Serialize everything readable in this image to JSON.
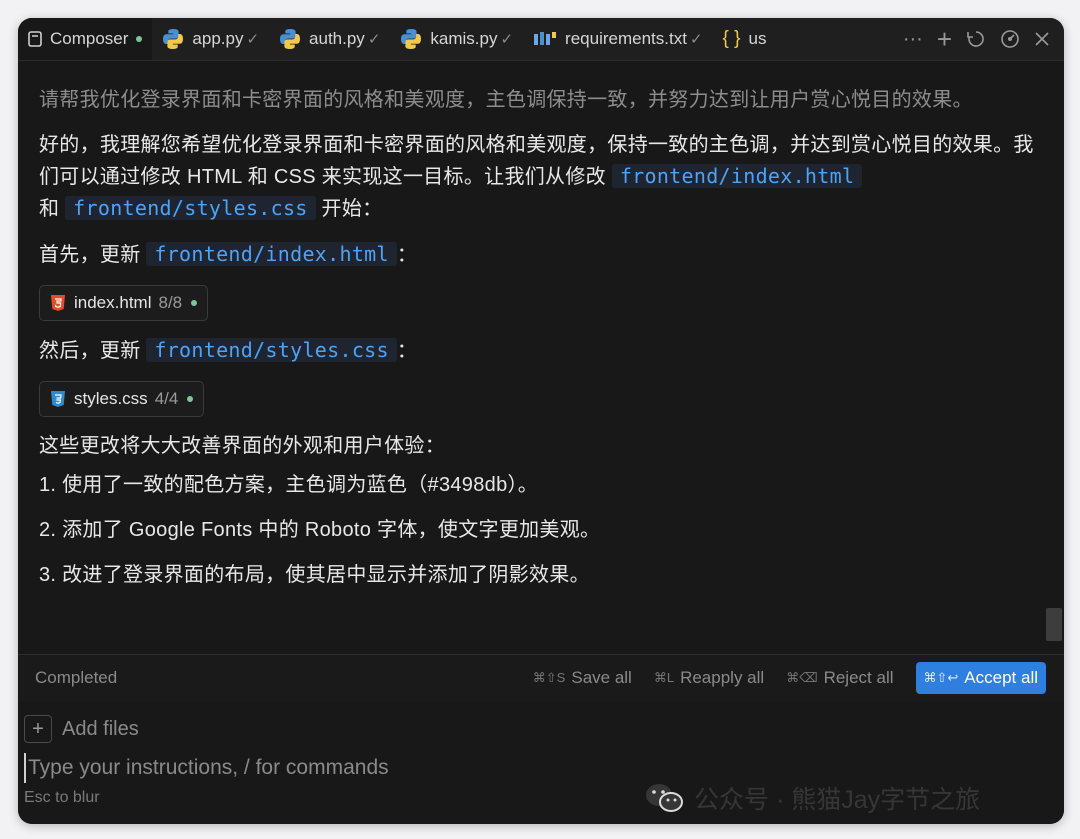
{
  "tabs": [
    {
      "label": "Composer",
      "icon": "document-icon",
      "status": "dot"
    },
    {
      "label": "app.py",
      "icon": "python-icon",
      "status": "check"
    },
    {
      "label": "auth.py",
      "icon": "python-icon",
      "status": "check"
    },
    {
      "label": "kamis.py",
      "icon": "python-icon",
      "status": "check"
    },
    {
      "label": "requirements.txt",
      "icon": "requirements-icon",
      "status": "check"
    },
    {
      "label": "us",
      "icon": "braces-icon",
      "status": ""
    }
  ],
  "tab_actions": {
    "more": "···",
    "add": "+"
  },
  "messages": {
    "user": "请帮我优化登录界面和卡密界面的风格和美观度，主色调保持一致，并努力达到让用户赏心悦目的效果。",
    "reply_p1_a": "好的，我理解您希望优化登录界面和卡密界面的风格和美观度，保持一致的主色调，并达到赏心悦目的效果。我们可以通过修改 HTML 和 CSS 来实现这一目标。让我们从修改",
    "reply_p1_code1": "frontend/index.html",
    "reply_p1_b": "和",
    "reply_p1_code2": "frontend/styles.css",
    "reply_p1_c": "开始：",
    "first_label": "首先，更新",
    "first_code": "frontend/index.html",
    "first_tail": "：",
    "chip1": {
      "name": "index.html",
      "count": "8/8"
    },
    "then_label": "然后，更新",
    "then_code": "frontend/styles.css",
    "then_tail": "：",
    "chip2": {
      "name": "styles.css",
      "count": "4/4"
    },
    "summary": "这些更改将大大改善界面的外观和用户体验：",
    "items": [
      "1. 使用了一致的配色方案，主色调为蓝色（#3498db）。",
      "2. 添加了 Google Fonts 中的 Roboto 字体，使文字更加美观。",
      "3. 改进了登录界面的布局，使其居中显示并添加了阴影效果。"
    ]
  },
  "statusbar": {
    "status": "Completed",
    "save": {
      "kbd": "⌘⇧S",
      "label": "Save all"
    },
    "reapply": {
      "kbd": "⌘L",
      "label": "Reapply all"
    },
    "reject": {
      "kbd": "⌘⌫",
      "label": "Reject all"
    },
    "accept": {
      "kbd": "⌘⇧↩",
      "label": "Accept all"
    }
  },
  "input": {
    "add_files": "Add files",
    "placeholder": "Type your instructions, / for commands",
    "hint": "Esc to blur"
  },
  "watermark": "公众号 · 熊猫Jay字节之旅",
  "colors": {
    "accent": "#2f7fe0",
    "code": "#4ea3f7",
    "dot": "#7ec699"
  }
}
